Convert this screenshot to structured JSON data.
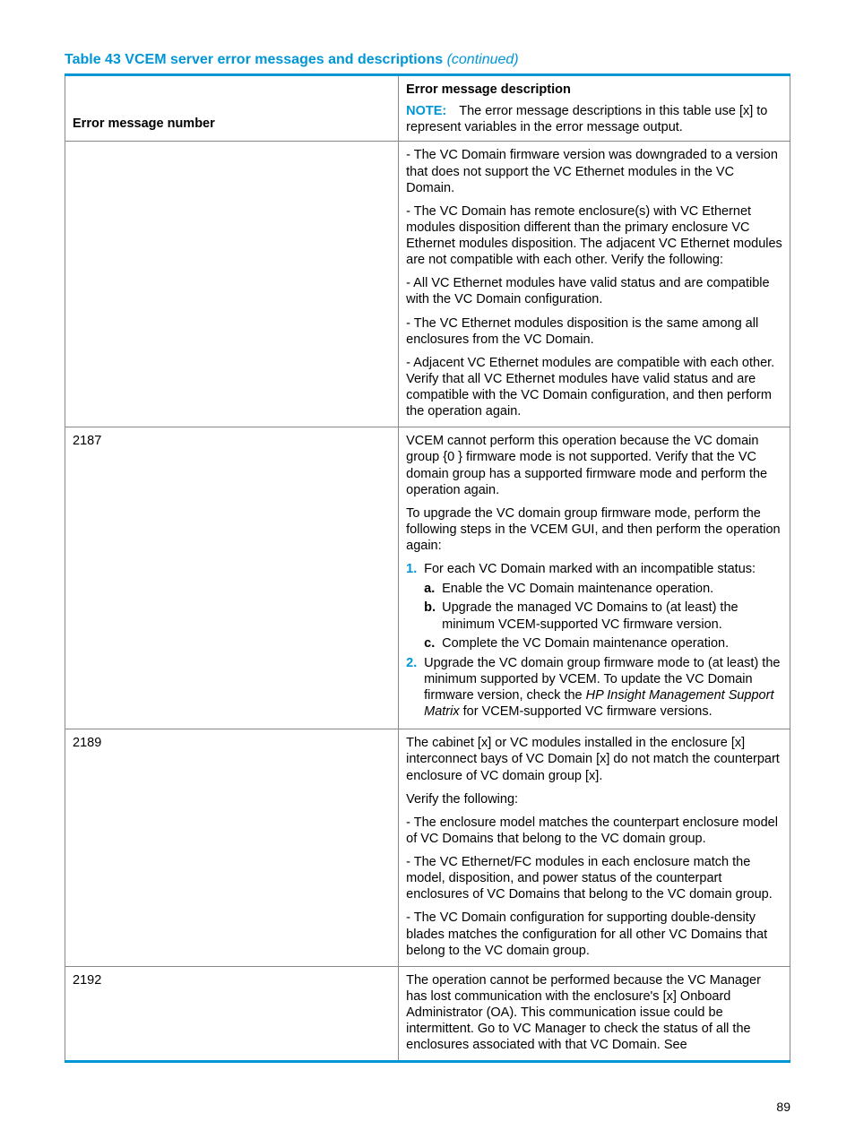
{
  "title_prefix": "Table 43 VCEM server error messages and descriptions",
  "title_suffix": "(continued)",
  "columns": {
    "left": "Error message number",
    "right_heading": "Error message description",
    "note_label": "NOTE:",
    "note_text": "The error message descriptions in this table use [x] to represent variables in the error message output."
  },
  "rows": {
    "r0": {
      "number": "",
      "p1": "- The VC Domain firmware version was downgraded to a version that does not support the VC Ethernet modules in the VC Domain.",
      "p2": "- The VC Domain has remote enclosure(s) with VC Ethernet modules disposition different than the primary enclosure VC Ethernet modules disposition. The adjacent VC Ethernet modules are not compatible with each other. Verify the following:",
      "p3": "- All VC Ethernet modules have valid status and are compatible with the VC Domain configuration.",
      "p4": "- The VC Ethernet modules disposition is the same among all enclosures from the VC Domain.",
      "p5": "- Adjacent VC Ethernet modules are compatible with each other. Verify that all VC Ethernet modules have valid status and are compatible with the VC Domain configuration, and then perform the operation again."
    },
    "r1": {
      "number": "2187",
      "p1": "VCEM cannot perform this operation because the VC domain group {0 } firmware mode is not supported. Verify that the VC domain group has a supported firmware mode and perform the operation again.",
      "p2": "To upgrade the VC domain group firmware mode, perform the following steps in the VCEM GUI, and then perform the operation again:",
      "li1_marker": "1.",
      "li1_text": "For each VC Domain marked with an incompatible status:",
      "li1a_marker": "a.",
      "li1a_text": "Enable the VC Domain maintenance operation.",
      "li1b_marker": "b.",
      "li1b_text": "Upgrade the managed VC Domains to (at least) the minimum VCEM-supported VC firmware version.",
      "li1c_marker": "c.",
      "li1c_text": "Complete the VC Domain maintenance operation.",
      "li2_marker": "2.",
      "li2_text_a": "Upgrade the VC domain group firmware mode to (at least) the minimum supported by VCEM. To update the VC Domain firmware version, check the ",
      "li2_text_italic": "HP Insight Management Support Matrix",
      "li2_text_b": " for VCEM-supported VC firmware versions."
    },
    "r2": {
      "number": "2189",
      "p1": "The cabinet [x] or VC modules installed in the enclosure [x] interconnect bays of VC Domain [x] do not match the counterpart enclosure of VC domain group [x].",
      "p2": "Verify the following:",
      "p3": "- The enclosure model matches the counterpart enclosure model of VC Domains that belong to the VC domain group.",
      "p4": "- The VC Ethernet/FC modules in each enclosure match the model, disposition, and power status of the counterpart enclosures of VC Domains that belong to the VC domain group.",
      "p5": "- The VC Domain configuration for supporting double-density blades matches the configuration for all other VC Domains that belong to the VC domain group."
    },
    "r3": {
      "number": "2192",
      "p1": "The operation cannot be performed because the VC Manager has lost communication with the enclosure's [x] Onboard Administrator (OA). This communication issue could be intermittent. Go to VC Manager to check the status of all the enclosures associated with that VC Domain. See"
    }
  },
  "page_number": "89"
}
